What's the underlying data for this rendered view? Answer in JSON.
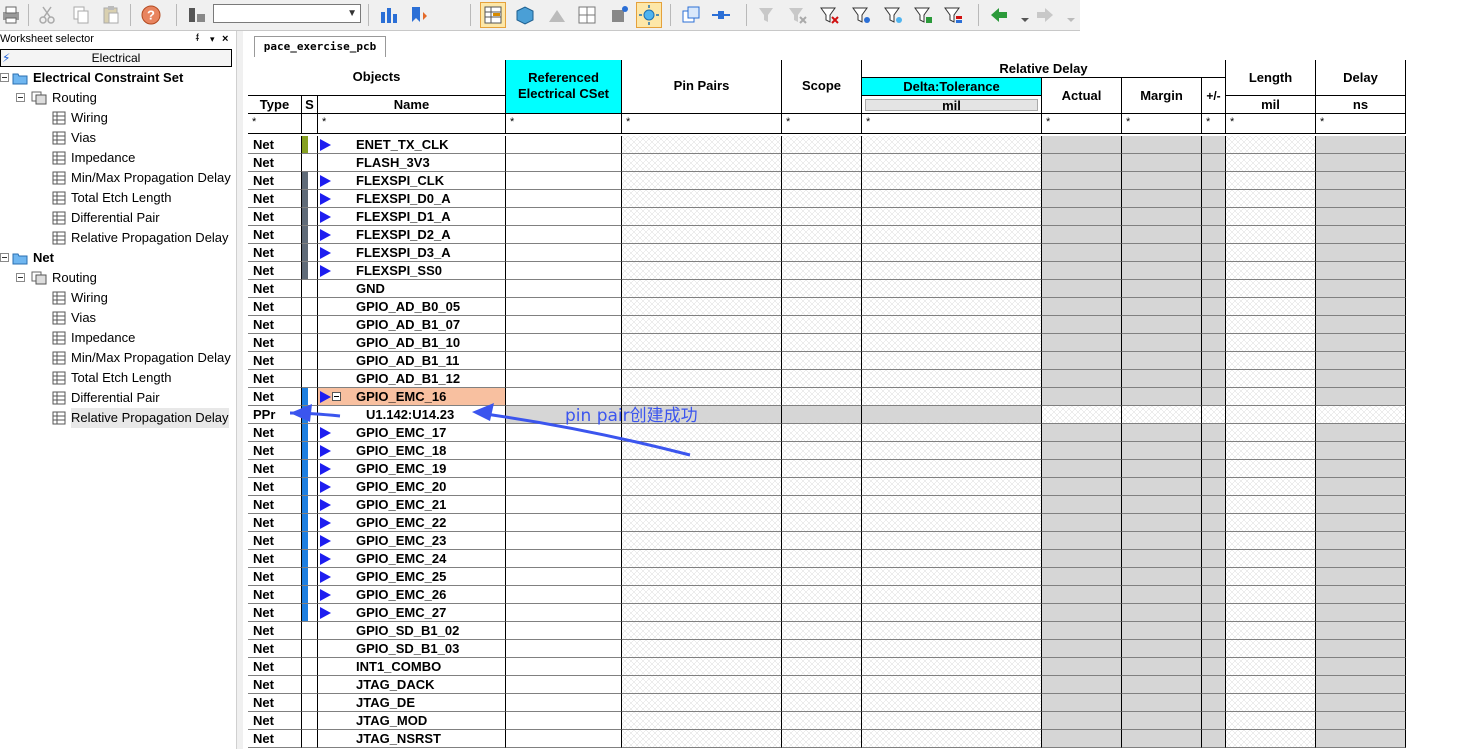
{
  "toolbar": {
    "combo_value": "",
    "icons": [
      "print-icon",
      "cut-icon",
      "copy-icon",
      "paste-icon",
      "help-icon",
      "filter-icon",
      "bar-chart-icon",
      "bookmark-icon",
      "table-icon",
      "cube-icon",
      "net-icon",
      "grid-icon",
      "puzzle-icon",
      "sun-icon",
      "windows-icon",
      "connect-icon",
      "funnel-icon",
      "funnel-x-icon",
      "funnel-down-icon",
      "funnel-star-icon",
      "funnel-spark-icon",
      "funnel-grid-icon",
      "funnel-color-icon",
      "back-arrow-icon",
      "forward-arrow-icon"
    ]
  },
  "worksheet_selector": {
    "title": "Worksheet selector",
    "pin": "ᵮ",
    "menu": "▾",
    "close": "×",
    "tab": "Electrical"
  },
  "tree": [
    {
      "label": "Electrical Constraint Set",
      "level": 0,
      "bold": true,
      "type": "folder"
    },
    {
      "label": "Routing",
      "level": 1,
      "type": "sheetgroup"
    },
    {
      "label": "Wiring",
      "level": 2,
      "type": "sheet"
    },
    {
      "label": "Vias",
      "level": 2,
      "type": "sheet"
    },
    {
      "label": "Impedance",
      "level": 2,
      "type": "sheet"
    },
    {
      "label": "Min/Max Propagation Delay",
      "level": 2,
      "type": "sheet"
    },
    {
      "label": "Total Etch Length",
      "level": 2,
      "type": "sheet"
    },
    {
      "label": "Differential Pair",
      "level": 2,
      "type": "sheet"
    },
    {
      "label": "Relative Propagation Delay",
      "level": 2,
      "type": "sheet"
    },
    {
      "label": "Net",
      "level": 0,
      "bold": true,
      "type": "folder"
    },
    {
      "label": "Routing",
      "level": 1,
      "type": "sheetgroup"
    },
    {
      "label": "Wiring",
      "level": 2,
      "type": "sheet"
    },
    {
      "label": "Vias",
      "level": 2,
      "type": "sheet"
    },
    {
      "label": "Impedance",
      "level": 2,
      "type": "sheet"
    },
    {
      "label": "Min/Max Propagation Delay",
      "level": 2,
      "type": "sheet"
    },
    {
      "label": "Total Etch Length",
      "level": 2,
      "type": "sheet"
    },
    {
      "label": "Differential Pair",
      "level": 2,
      "type": "sheet"
    },
    {
      "label": "Relative Propagation Delay",
      "level": 2,
      "type": "sheet",
      "selected": true
    }
  ],
  "doc_tab": "pace_exercise_pcb",
  "grid": {
    "headers": {
      "objects": "Objects",
      "type": "Type",
      "s": "S",
      "name": "Name",
      "ref_cset": "Referenced Electrical CSet",
      "pin_pairs": "Pin Pairs",
      "scope": "Scope",
      "relative_delay": "Relative Delay",
      "delta_tolerance": "Delta:Tolerance",
      "delta_unit": "mil",
      "actual": "Actual",
      "margin": "Margin",
      "plusminus": "+/-",
      "length": "Length",
      "length_unit": "mil",
      "delay": "Delay",
      "delay_unit": "ns"
    },
    "filter_value": "*",
    "rows": [
      {
        "type": "Net",
        "name": "ENET_TX_CLK",
        "s_color": "#86a020",
        "flag": true
      },
      {
        "type": "Net",
        "name": "FLASH_3V3",
        "s_color": "",
        "flag": false
      },
      {
        "type": "Net",
        "name": "FLEXSPI_CLK",
        "s_color": "#5f6b78",
        "flag": true
      },
      {
        "type": "Net",
        "name": "FLEXSPI_D0_A",
        "s_color": "#5f6b78",
        "flag": true
      },
      {
        "type": "Net",
        "name": "FLEXSPI_D1_A",
        "s_color": "#5f6b78",
        "flag": true
      },
      {
        "type": "Net",
        "name": "FLEXSPI_D2_A",
        "s_color": "#5f6b78",
        "flag": true
      },
      {
        "type": "Net",
        "name": "FLEXSPI_D3_A",
        "s_color": "#5f6b78",
        "flag": true
      },
      {
        "type": "Net",
        "name": "FLEXSPI_SS0",
        "s_color": "#5f6b78",
        "flag": true
      },
      {
        "type": "Net",
        "name": "GND",
        "s_color": "",
        "flag": false
      },
      {
        "type": "Net",
        "name": "GPIO_AD_B0_05",
        "s_color": "",
        "flag": false
      },
      {
        "type": "Net",
        "name": "GPIO_AD_B1_07",
        "s_color": "",
        "flag": false
      },
      {
        "type": "Net",
        "name": "GPIO_AD_B1_10",
        "s_color": "",
        "flag": false
      },
      {
        "type": "Net",
        "name": "GPIO_AD_B1_11",
        "s_color": "",
        "flag": false
      },
      {
        "type": "Net",
        "name": "GPIO_AD_B1_12",
        "s_color": "",
        "flag": false
      },
      {
        "type": "Net",
        "name": "GPIO_EMC_16",
        "s_color": "#1e7fe0",
        "flag": true,
        "selected": true,
        "expanded": true
      },
      {
        "type": "PPr",
        "name": "U1.142:U14.23",
        "s_color": "#1e7fe0",
        "flag": false,
        "pinpair": true
      },
      {
        "type": "Net",
        "name": "GPIO_EMC_17",
        "s_color": "#1e7fe0",
        "flag": true
      },
      {
        "type": "Net",
        "name": "GPIO_EMC_18",
        "s_color": "#1e7fe0",
        "flag": true
      },
      {
        "type": "Net",
        "name": "GPIO_EMC_19",
        "s_color": "#1e7fe0",
        "flag": true
      },
      {
        "type": "Net",
        "name": "GPIO_EMC_20",
        "s_color": "#1e7fe0",
        "flag": true
      },
      {
        "type": "Net",
        "name": "GPIO_EMC_21",
        "s_color": "#1e7fe0",
        "flag": true
      },
      {
        "type": "Net",
        "name": "GPIO_EMC_22",
        "s_color": "#1e7fe0",
        "flag": true
      },
      {
        "type": "Net",
        "name": "GPIO_EMC_23",
        "s_color": "#1e7fe0",
        "flag": true
      },
      {
        "type": "Net",
        "name": "GPIO_EMC_24",
        "s_color": "#1e7fe0",
        "flag": true
      },
      {
        "type": "Net",
        "name": "GPIO_EMC_25",
        "s_color": "#1e7fe0",
        "flag": true
      },
      {
        "type": "Net",
        "name": "GPIO_EMC_26",
        "s_color": "#1e7fe0",
        "flag": true
      },
      {
        "type": "Net",
        "name": "GPIO_EMC_27",
        "s_color": "#1e7fe0",
        "flag": true
      },
      {
        "type": "Net",
        "name": "GPIO_SD_B1_02",
        "s_color": "",
        "flag": false
      },
      {
        "type": "Net",
        "name": "GPIO_SD_B1_03",
        "s_color": "",
        "flag": false
      },
      {
        "type": "Net",
        "name": "INT1_COMBO",
        "s_color": "",
        "flag": false
      },
      {
        "type": "Net",
        "name": "JTAG_DACK",
        "s_color": "",
        "flag": false
      },
      {
        "type": "Net",
        "name": "JTAG_DE",
        "s_color": "",
        "flag": false
      },
      {
        "type": "Net",
        "name": "JTAG_MOD",
        "s_color": "",
        "flag": false
      },
      {
        "type": "Net",
        "name": "JTAG_NSRST",
        "s_color": "",
        "flag": false
      }
    ]
  },
  "annotation": {
    "text": "pin pair创建成功",
    "color": "#3b55ee"
  }
}
